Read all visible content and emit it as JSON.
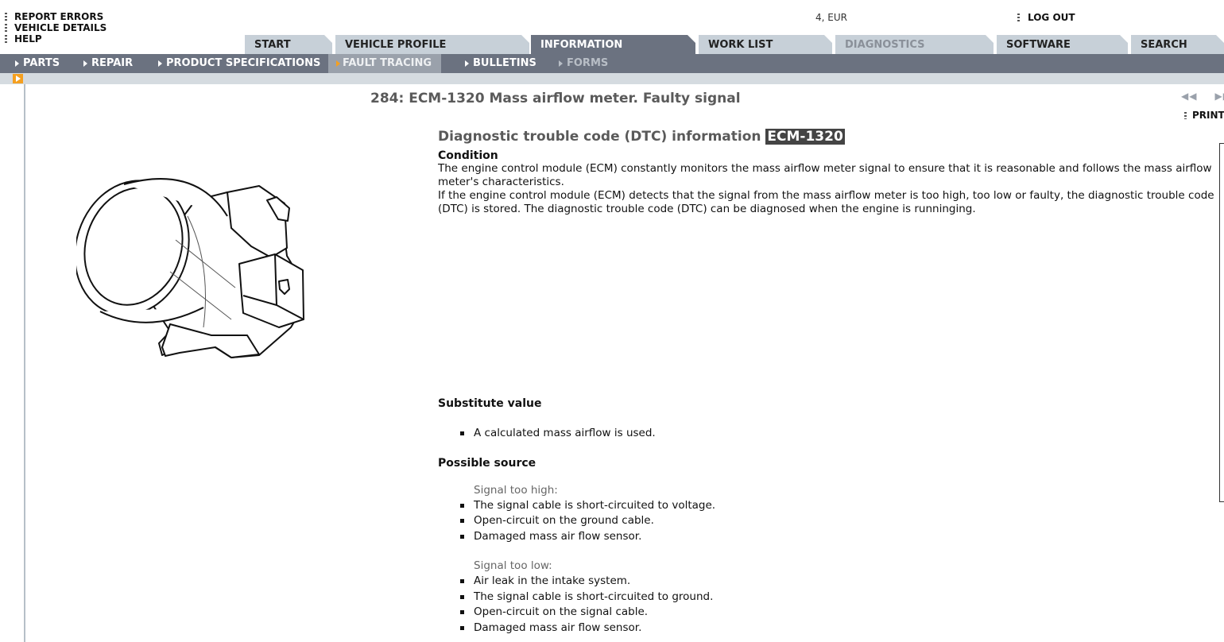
{
  "top_links": [
    "REPORT ERRORS",
    "VEHICLE DETAILS",
    "HELP"
  ],
  "market": "4, EUR",
  "logout_label": "LOG OUT",
  "tabs": [
    "START",
    "VEHICLE PROFILE",
    "INFORMATION",
    "WORK LIST",
    "DIAGNOSTICS",
    "SOFTWARE",
    "SEARCH"
  ],
  "active_tab": "INFORMATION",
  "disabled_tab": "DIAGNOSTICS",
  "subnav": [
    "PARTS",
    "REPAIR",
    "PRODUCT SPECIFICATIONS",
    "FAULT TRACING",
    "BULLETINS",
    "FORMS"
  ],
  "active_subnav": "FAULT TRACING",
  "doc_title": "284: ECM-1320 Mass airflow meter. Faulty signal",
  "pager": {
    "prev": "◀◀",
    "next": "▶▶"
  },
  "print_label": "PRINT",
  "dtc": {
    "heading": "Diagnostic trouble code (DTC) information",
    "code": "ECM-1320",
    "condition_label": "Condition",
    "condition_p1": "The engine control module (ECM) constantly monitors the mass airflow meter signal to ensure that it is reasonable and follows the mass airflow meter's characteristics.",
    "condition_p2": "If the engine control module (ECM) detects that the signal from the mass airflow meter is too high, too low or faulty, the diagnostic trouble code (DTC) is stored. The diagnostic trouble code (DTC) can be diagnosed when the engine is runninging."
  },
  "substitute": {
    "label": "Substitute value",
    "items": [
      "A calculated mass airflow is used."
    ]
  },
  "possible": {
    "label": "Possible source",
    "high_label": "Signal too high:",
    "high_items": [
      "The signal cable is short-circuited to voltage.",
      "Open-circuit on the ground cable.",
      "Damaged mass air flow sensor."
    ],
    "low_label": "Signal too low:",
    "low_items": [
      "Air leak in the intake system.",
      "The signal cable is short-circuited to ground.",
      "Open-circuit on the signal cable.",
      "Damaged mass air flow sensor."
    ]
  },
  "colors": {
    "accent": "#f5a020",
    "nav_bg": "#6b7280",
    "tab_bg": "#c7d0d8"
  }
}
